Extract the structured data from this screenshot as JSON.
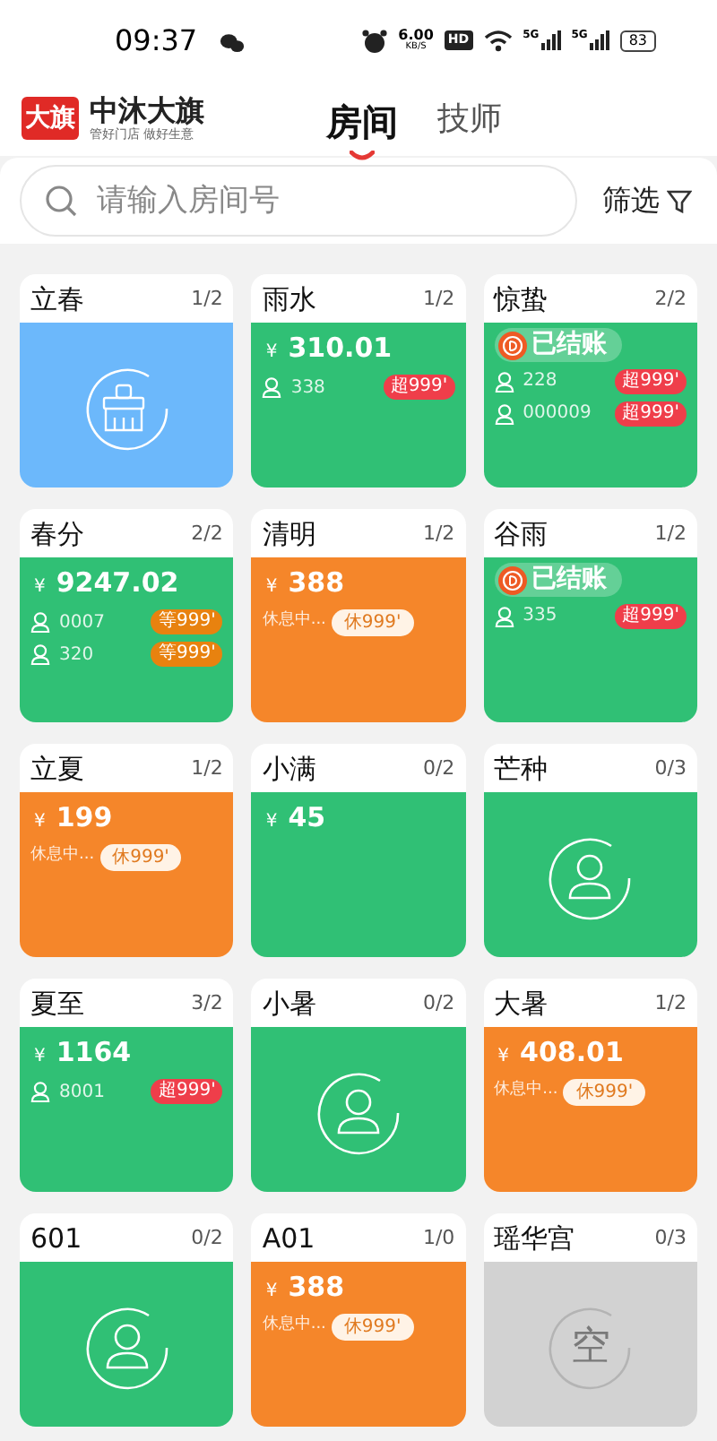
{
  "status_bar": {
    "time": "09:37",
    "net_speed": "6.00",
    "net_unit": "KB/S",
    "hd": "HD",
    "sim1": "5G",
    "sim2": "5G",
    "battery": "83"
  },
  "header": {
    "logo_mark": "大旗",
    "brand": "中沐大旗",
    "slogan": "管好门店 做好生意",
    "tabs": [
      {
        "label": "房间",
        "selected": true
      },
      {
        "label": "技师",
        "selected": false
      }
    ]
  },
  "search": {
    "placeholder": "请输入房间号",
    "filter": "筛选"
  },
  "rooms": [
    {
      "name": "立春",
      "count": "1/2",
      "kind": "cleaning"
    },
    {
      "name": "雨水",
      "count": "1/2",
      "kind": "occupied",
      "currency": "¥",
      "amount": "310.01",
      "customers": [
        {
          "id": "338",
          "tag": "超999'",
          "color": "#ef3e4a"
        }
      ]
    },
    {
      "name": "惊蛰",
      "count": "2/2",
      "kind": "occupied",
      "settled": "已结账",
      "customers": [
        {
          "id": "228",
          "tag": "超999'",
          "color": "#ef3e4a"
        },
        {
          "id": "000009",
          "tag": "超999'",
          "color": "#ef3e4a"
        }
      ]
    },
    {
      "name": "春分",
      "count": "2/2",
      "kind": "occupied",
      "currency": "¥",
      "amount": "9247.02",
      "customers": [
        {
          "id": "0007",
          "tag": "等999'",
          "color": "#e8820f"
        },
        {
          "id": "320",
          "tag": "等999'",
          "color": "#e8820f"
        }
      ]
    },
    {
      "name": "清明",
      "count": "1/2",
      "kind": "resting",
      "currency": "¥",
      "amount": "388",
      "rest": "休息中...",
      "rest_tag": "休999'"
    },
    {
      "name": "谷雨",
      "count": "1/2",
      "kind": "occupied",
      "settled": "已结账",
      "customers": [
        {
          "id": "335",
          "tag": "超999'",
          "color": "#ef3e4a"
        }
      ]
    },
    {
      "name": "立夏",
      "count": "1/2",
      "kind": "resting",
      "currency": "¥",
      "amount": "199",
      "rest": "休息中...",
      "rest_tag": "休999'"
    },
    {
      "name": "小满",
      "count": "0/2",
      "kind": "occupied",
      "currency": "¥",
      "amount": "45"
    },
    {
      "name": "芒种",
      "count": "0/3",
      "kind": "free"
    },
    {
      "name": "夏至",
      "count": "3/2",
      "kind": "occupied",
      "currency": "¥",
      "amount": "1164",
      "customers": [
        {
          "id": "8001",
          "tag": "超999'",
          "color": "#ef3e4a"
        }
      ]
    },
    {
      "name": "小暑",
      "count": "0/2",
      "kind": "free"
    },
    {
      "name": "大暑",
      "count": "1/2",
      "kind": "resting",
      "currency": "¥",
      "amount": "408.01",
      "rest": "休息中...",
      "rest_tag": "休999'"
    },
    {
      "name": "601",
      "count": "0/2",
      "kind": "free"
    },
    {
      "name": "A01",
      "count": "1/0",
      "kind": "resting",
      "currency": "¥",
      "amount": "388",
      "rest": "休息中...",
      "rest_tag": "休999'"
    },
    {
      "name": "瑶华宫",
      "count": "0/3",
      "kind": "empty",
      "empty_mark": "空"
    }
  ]
}
